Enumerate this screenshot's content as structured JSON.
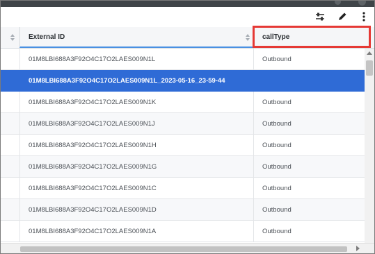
{
  "toolbar": {
    "icons": [
      "filter-sliders-icon",
      "pencil-icon",
      "more-vertical-icon"
    ]
  },
  "table": {
    "columns": [
      {
        "label": ""
      },
      {
        "label": "External ID"
      },
      {
        "label": "callType"
      }
    ],
    "rows": [
      {
        "external_id": "01M8LBI688A3F92O4C17O2LAES009N1L",
        "call_type": "Outbound"
      },
      {
        "external_id": "01M8LBI688A3F92O4C17O2LAES009N1L_2023-05-16_23-59-44",
        "call_type": ""
      },
      {
        "external_id": "01M8LBI688A3F92O4C17O2LAES009N1K",
        "call_type": "Outbound"
      },
      {
        "external_id": "01M8LBI688A3F92O4C17O2LAES009N1J",
        "call_type": "Outbound"
      },
      {
        "external_id": "01M8LBI688A3F92O4C17O2LAES009N1H",
        "call_type": "Outbound"
      },
      {
        "external_id": "01M8LBI688A3F92O4C17O2LAES009N1G",
        "call_type": "Outbound"
      },
      {
        "external_id": "01M8LBI688A3F92O4C17O2LAES009N1C",
        "call_type": "Outbound"
      },
      {
        "external_id": "01M8LBI688A3F92O4C17O2LAES009N1D",
        "call_type": "Outbound"
      },
      {
        "external_id": "01M8LBI688A3F92O4C17O2LAES009N1A",
        "call_type": "Outbound"
      }
    ],
    "selected_row": 1
  },
  "colors": {
    "selected_row": "#2f6bd6",
    "highlight": "#e53935",
    "sort_underline": "#4a90e2"
  }
}
